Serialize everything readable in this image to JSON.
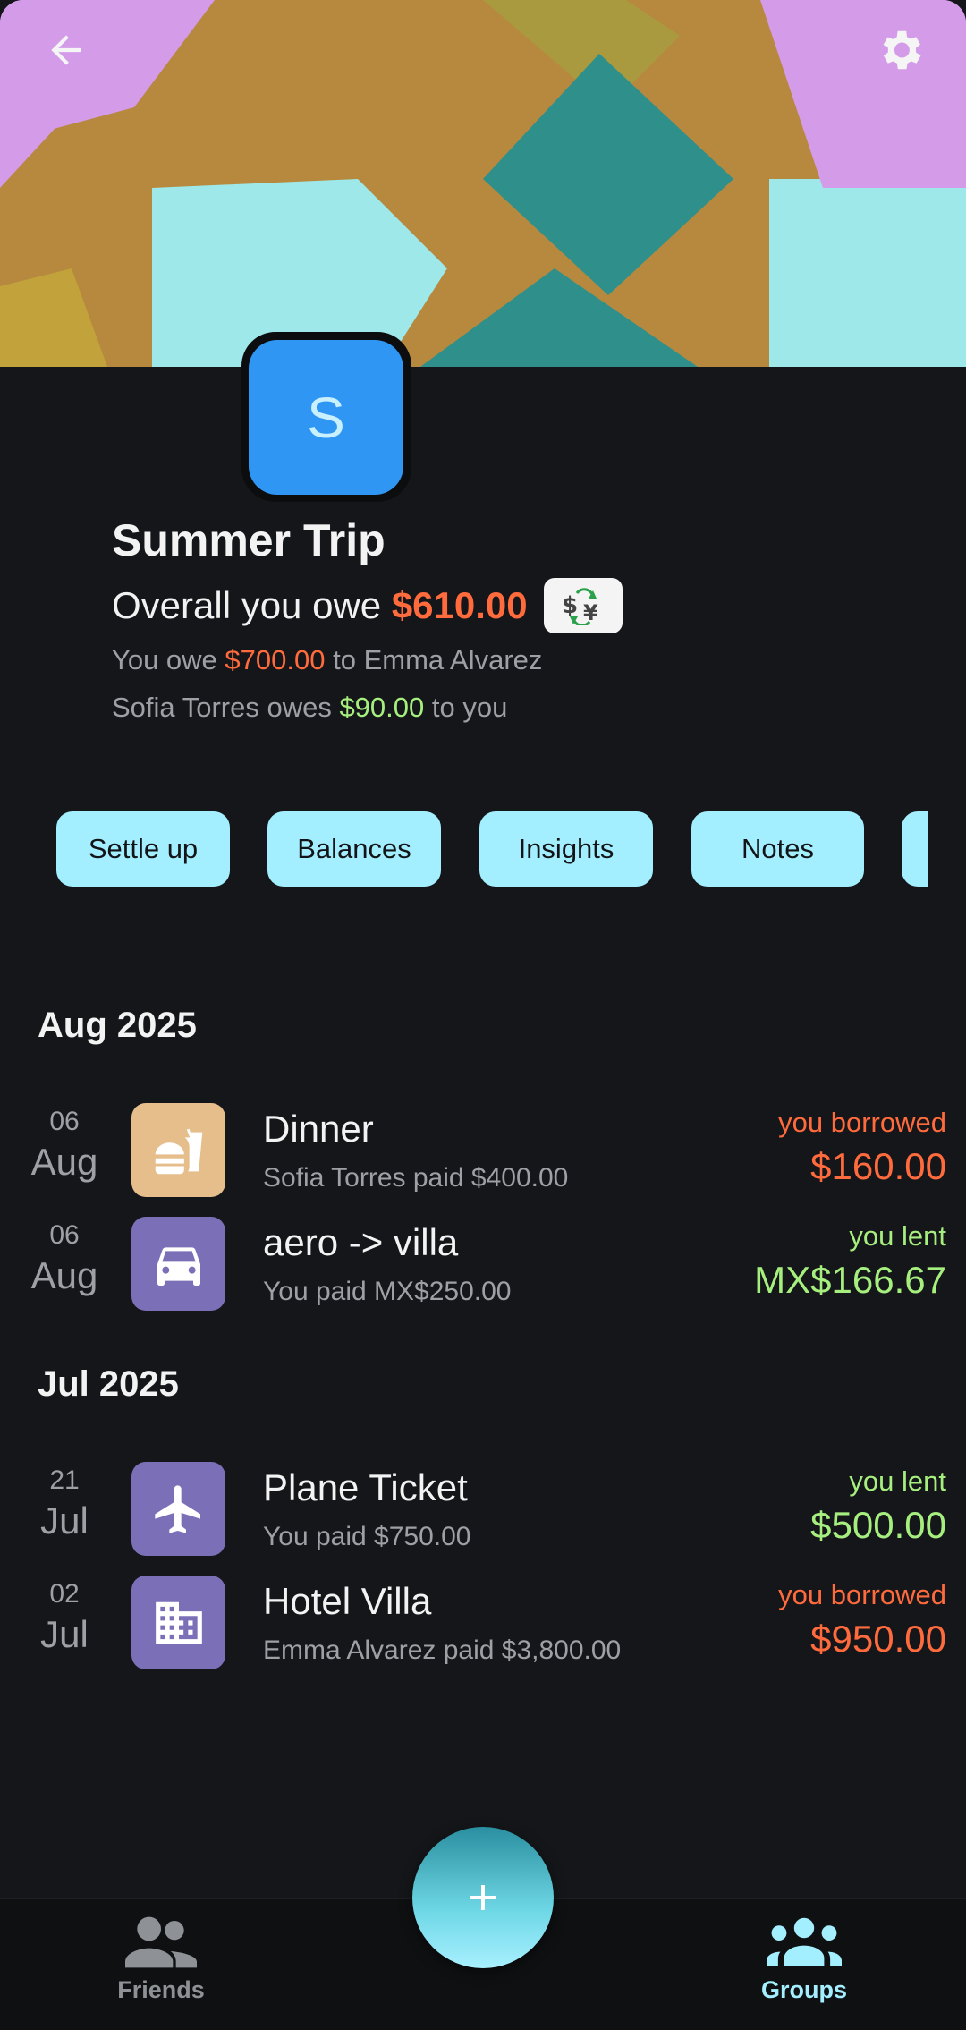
{
  "group": {
    "name": "Summer Trip",
    "initial": "S",
    "overall_prefix": "Overall you owe ",
    "overall_amount": "$610.00",
    "lines": [
      {
        "before": "You owe ",
        "amount": "$700.00",
        "after": " to Emma Alvarez"
      },
      {
        "before": "Sofia Torres owes ",
        "amount": "$90.00",
        "after": " to you"
      }
    ]
  },
  "actions": [
    "Settle up",
    "Balances",
    "Insights",
    "Notes"
  ],
  "sections": [
    {
      "month": "Aug 2025",
      "items": [
        {
          "day": "06",
          "mon": "Aug",
          "icon": "fast-food-icon",
          "icon_bg": "#e5be8c",
          "title": "Dinner",
          "subtitle": "Sofia Torres paid $400.00",
          "status": "you borrowed",
          "amount": "$160.00",
          "tone": "red"
        },
        {
          "day": "06",
          "mon": "Aug",
          "icon": "car-icon",
          "icon_bg": "#7b70b8",
          "title": "aero -> villa",
          "subtitle": "You paid MX$250.00",
          "status": "you lent",
          "amount": "MX$166.67",
          "tone": "green"
        }
      ]
    },
    {
      "month": "Jul 2025",
      "items": [
        {
          "day": "21",
          "mon": "Jul",
          "icon": "airplane-icon",
          "icon_bg": "#7b70b8",
          "title": "Plane Ticket",
          "subtitle": "You paid $750.00",
          "status": "you lent",
          "amount": "$500.00",
          "tone": "green"
        },
        {
          "day": "02",
          "mon": "Jul",
          "icon": "building-icon",
          "icon_bg": "#7b70b8",
          "title": "Hotel Villa",
          "subtitle": "Emma Alvarez paid $3,800.00",
          "status": "you borrowed",
          "amount": "$950.00",
          "tone": "red"
        }
      ]
    }
  ],
  "nav": {
    "friends": "Friends",
    "groups": "Groups",
    "active": "groups"
  },
  "colors": {
    "negative": "#ff6b3d",
    "positive": "#a6ef7f",
    "accent": "#a4efff",
    "avatar": "#2f97f3"
  }
}
